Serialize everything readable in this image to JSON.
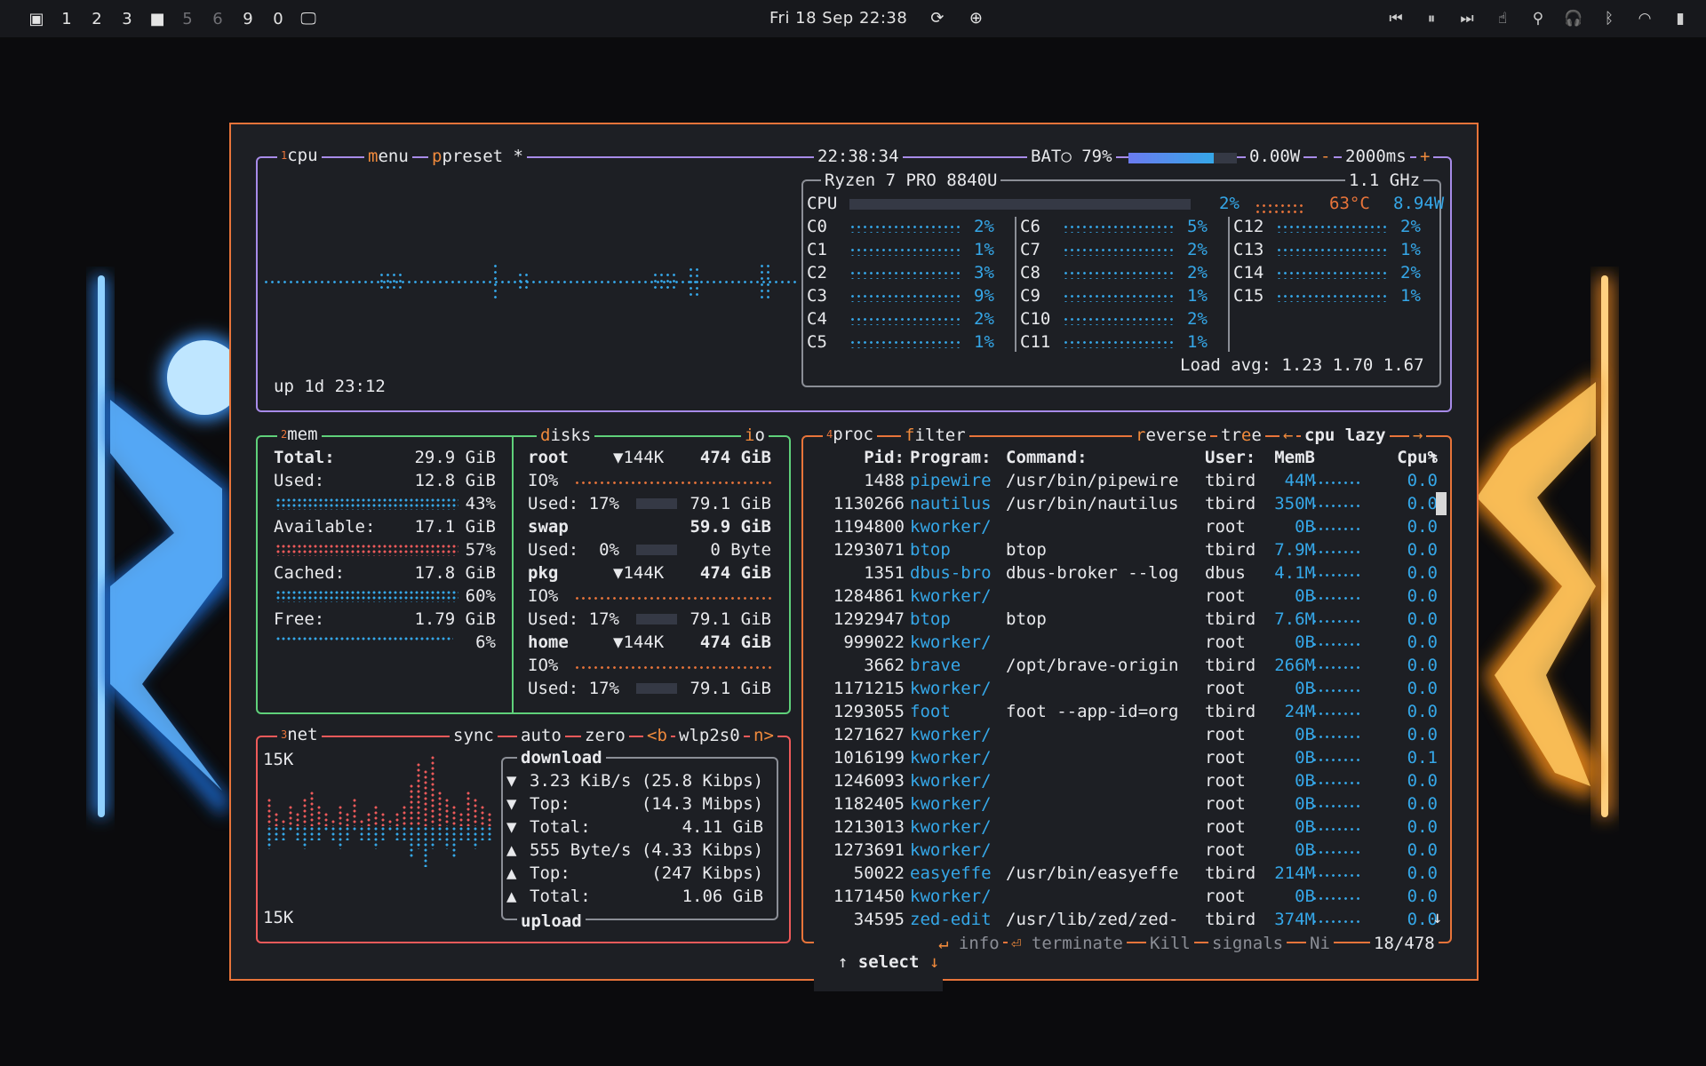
{
  "topbar": {
    "workspaces": [
      "1",
      "2",
      "3",
      "5",
      "6",
      "9",
      "0"
    ],
    "clock": "Fri 18 Sep 22:38"
  },
  "cpu": {
    "title": "cpu",
    "menu": "menu",
    "preset": "preset *",
    "time": "22:38:34",
    "battery": "BAT○ 79%",
    "battery_fill": 0.79,
    "power": "0.00W",
    "interval": "2000ms",
    "interval_minus": "-",
    "interval_plus": "+",
    "model": "Ryzen 7 PRO 8840U",
    "freq": "1.1 GHz",
    "total_label": "CPU",
    "total": "2%",
    "temp": "63°C",
    "watts": "8.94W",
    "uptime": "up 1d 23:12",
    "load": "Load avg: 1.23 1.70 1.67",
    "cores": [
      {
        "n": "C0",
        "v": "2%"
      },
      {
        "n": "C1",
        "v": "1%"
      },
      {
        "n": "C2",
        "v": "3%"
      },
      {
        "n": "C3",
        "v": "9%"
      },
      {
        "n": "C4",
        "v": "2%"
      },
      {
        "n": "C5",
        "v": "1%"
      },
      {
        "n": "C6",
        "v": "5%"
      },
      {
        "n": "C7",
        "v": "2%"
      },
      {
        "n": "C8",
        "v": "2%"
      },
      {
        "n": "C9",
        "v": "1%"
      },
      {
        "n": "C10",
        "v": "2%"
      },
      {
        "n": "C11",
        "v": "1%"
      },
      {
        "n": "C12",
        "v": "2%"
      },
      {
        "n": "C13",
        "v": "1%"
      },
      {
        "n": "C14",
        "v": "2%"
      },
      {
        "n": "C15",
        "v": "1%"
      }
    ]
  },
  "mem": {
    "title": "mem",
    "total_label": "Total:",
    "total": "29.9 GiB",
    "used_label": "Used:",
    "used": "12.8 GiB",
    "used_pct": "43%",
    "avail_label": "Available:",
    "avail": "17.1 GiB",
    "avail_pct": "57%",
    "cached_label": "Cached:",
    "cached": "17.8 GiB",
    "cached_pct": "60%",
    "free_label": "Free:",
    "free": "1.79 GiB",
    "free_pct": "6%"
  },
  "disks": {
    "title": "disks",
    "io": "io",
    "items": [
      {
        "name": "root",
        "io": "▼144K",
        "size": "474 GiB",
        "io_label": "IO%",
        "used_label": "Used: 17%",
        "used": "79.1 GiB"
      },
      {
        "name": "swap",
        "io": "",
        "size": "59.9 GiB",
        "io_label": "",
        "used_label": "Used:  0%",
        "used": "0 Byte"
      },
      {
        "name": "pkg",
        "io": "▼144K",
        "size": "474 GiB",
        "io_label": "IO%",
        "used_label": "Used: 17%",
        "used": "79.1 GiB"
      },
      {
        "name": "home",
        "io": "▼144K",
        "size": "474 GiB",
        "io_label": "IO%",
        "used_label": "Used: 17%",
        "used": "79.1 GiB"
      }
    ]
  },
  "net": {
    "title": "net",
    "sync": "sync",
    "auto": "auto",
    "zero": "zero",
    "prev": "<b",
    "iface": "wlp2s0",
    "next": "n>",
    "scale_top": "15K",
    "scale_bottom": "15K",
    "download_label": "download",
    "upload_label": "upload",
    "rows": [
      {
        "arrow": "▼",
        "text": "3.23 KiB/s (25.8 Kibps)"
      },
      {
        "arrow": "▼",
        "text": "Top:       (14.3 Mibps)"
      },
      {
        "arrow": "▼",
        "text": "Total:         4.11 GiB"
      },
      {
        "arrow": "▲",
        "text": "555 Byte/s (4.33 Kibps)"
      },
      {
        "arrow": "▲",
        "text": "Top:        (247 Kibps)"
      },
      {
        "arrow": "▲",
        "text": "Total:         1.06 GiB"
      }
    ]
  },
  "proc": {
    "title": "proc",
    "filter": "filter",
    "reverse": "reverse",
    "tree": "tree",
    "sort": "cpu lazy",
    "sort_prev": "←",
    "sort_next": "→",
    "headers": {
      "pid": "Pid:",
      "program": "Program:",
      "command": "Command:",
      "user": "User:",
      "mem": "MemB",
      "cpu": "Cpu%"
    },
    "rows": [
      {
        "pid": "1488",
        "program": "pipewire",
        "command": "/usr/bin/pipewire",
        "user": "tbird",
        "mem": "44M",
        "cpu": "0.0"
      },
      {
        "pid": "1130266",
        "program": "nautilus",
        "command": "/usr/bin/nautilus",
        "user": "tbird",
        "mem": "350M",
        "cpu": "0.0"
      },
      {
        "pid": "1194800",
        "program": "kworker/",
        "command": "",
        "user": "root",
        "mem": "0B",
        "cpu": "0.0"
      },
      {
        "pid": "1293071",
        "program": "btop",
        "command": "btop",
        "user": "tbird",
        "mem": "7.9M",
        "cpu": "0.0"
      },
      {
        "pid": "1351",
        "program": "dbus-bro",
        "command": "dbus-broker --log",
        "user": "dbus",
        "mem": "4.1M",
        "cpu": "0.0"
      },
      {
        "pid": "1284861",
        "program": "kworker/",
        "command": "",
        "user": "root",
        "mem": "0B",
        "cpu": "0.0"
      },
      {
        "pid": "1292947",
        "program": "btop",
        "command": "btop",
        "user": "tbird",
        "mem": "7.6M",
        "cpu": "0.0"
      },
      {
        "pid": "999022",
        "program": "kworker/",
        "command": "",
        "user": "root",
        "mem": "0B",
        "cpu": "0.0"
      },
      {
        "pid": "3662",
        "program": "brave",
        "command": "/opt/brave-origin",
        "user": "tbird",
        "mem": "266M",
        "cpu": "0.0"
      },
      {
        "pid": "1171215",
        "program": "kworker/",
        "command": "",
        "user": "root",
        "mem": "0B",
        "cpu": "0.0"
      },
      {
        "pid": "1293055",
        "program": "foot",
        "command": "foot --app-id=org",
        "user": "tbird",
        "mem": "24M",
        "cpu": "0.0"
      },
      {
        "pid": "1271627",
        "program": "kworker/",
        "command": "",
        "user": "root",
        "mem": "0B",
        "cpu": "0.0"
      },
      {
        "pid": "1016199",
        "program": "kworker/",
        "command": "",
        "user": "root",
        "mem": "0B",
        "cpu": "0.1"
      },
      {
        "pid": "1246093",
        "program": "kworker/",
        "command": "",
        "user": "root",
        "mem": "0B",
        "cpu": "0.0"
      },
      {
        "pid": "1182405",
        "program": "kworker/",
        "command": "",
        "user": "root",
        "mem": "0B",
        "cpu": "0.0"
      },
      {
        "pid": "1213013",
        "program": "kworker/",
        "command": "",
        "user": "root",
        "mem": "0B",
        "cpu": "0.0"
      },
      {
        "pid": "1273691",
        "program": "kworker/",
        "command": "",
        "user": "root",
        "mem": "0B",
        "cpu": "0.0"
      },
      {
        "pid": "50022",
        "program": "easyeffe",
        "command": "/usr/bin/easyeffe",
        "user": "tbird",
        "mem": "214M",
        "cpu": "0.0"
      },
      {
        "pid": "1171450",
        "program": "kworker/",
        "command": "",
        "user": "root",
        "mem": "0B",
        "cpu": "0.0"
      },
      {
        "pid": "34595",
        "program": "zed-edit",
        "command": "/usr/lib/zed/zed-",
        "user": "tbird",
        "mem": "374M",
        "cpu": "0.0"
      }
    ],
    "footer": {
      "select": "select",
      "info": "info",
      "terminate": "terminate",
      "kill": "Kill",
      "signals": "signals",
      "nice": "Ni",
      "count": "18/478"
    }
  },
  "colors": {
    "cpu": "#a78be8",
    "mem": "#5fd07a",
    "net": "#ee5a5a",
    "proc": "#e8743a",
    "value": "#35a7e8",
    "bg": "#1d1f24"
  }
}
